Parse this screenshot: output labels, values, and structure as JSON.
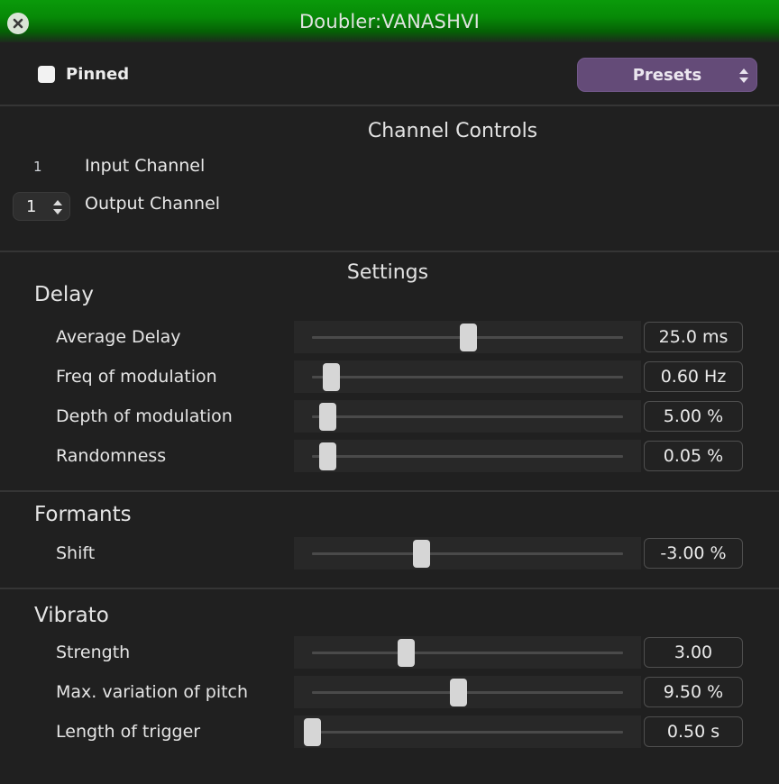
{
  "window": {
    "title": "Doubler:VANASHVI",
    "titlebar_color": "#078a07",
    "close_icon": "close-icon"
  },
  "header": {
    "pinned_label": "Pinned",
    "pinned_checked": false,
    "presets_label": "Presets",
    "presets_color": "#644b78"
  },
  "channel_controls": {
    "title": "Channel Controls",
    "input_channel_value": "1",
    "input_channel_label": "Input Channel",
    "output_channel_value": "1",
    "output_channel_label": "Output Channel"
  },
  "settings": {
    "title": "Settings",
    "groups": [
      {
        "title": "Delay",
        "params": [
          {
            "label": "Average Delay",
            "value": "25.0 ms",
            "position": 0.5
          },
          {
            "label": "Freq of modulation",
            "value": "0.60 Hz",
            "position": 0.06
          },
          {
            "label": "Depth of modulation",
            "value": "5.00 %",
            "position": 0.05
          },
          {
            "label": "Randomness",
            "value": "0.05 %",
            "position": 0.05
          }
        ]
      },
      {
        "title": "Formants",
        "params": [
          {
            "label": "Shift",
            "value": "-3.00 %",
            "position": 0.35
          }
        ]
      },
      {
        "title": "Vibrato",
        "params": [
          {
            "label": "Strength",
            "value": "3.00",
            "position": 0.3
          },
          {
            "label": "Max. variation of pitch",
            "value": "9.50 %",
            "position": 0.47
          },
          {
            "label": "Length of trigger",
            "value": "0.50 s",
            "position": 0.0
          }
        ]
      }
    ]
  }
}
